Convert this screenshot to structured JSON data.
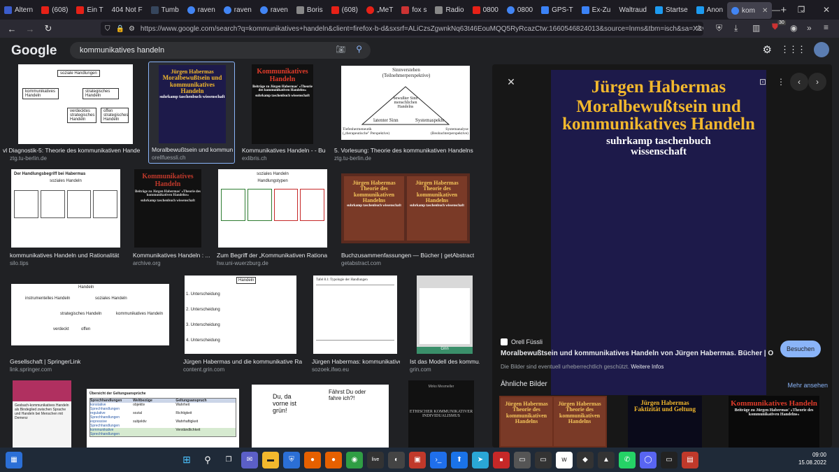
{
  "browser": {
    "tabs": [
      {
        "label": "Altern",
        "color": "#3b5ccc"
      },
      {
        "label": "(608)",
        "color": "#e62117"
      },
      {
        "label": "Ein T",
        "color": "#e62117"
      },
      {
        "label": "404 Not F",
        "color": "#555555"
      },
      {
        "label": "Tumb",
        "color": "#36465d"
      },
      {
        "label": "raven",
        "color": "#4285f4"
      },
      {
        "label": "raven",
        "color": "#4285f4"
      },
      {
        "label": "raven",
        "color": "#4285f4"
      },
      {
        "label": "Boris",
        "color": "#888888"
      },
      {
        "label": "(608)",
        "color": "#e62117"
      },
      {
        "label": "„MeT",
        "color": "#e62117"
      },
      {
        "label": "fox s",
        "color": "#cc3333"
      },
      {
        "label": "Radio",
        "color": "#888888"
      },
      {
        "label": "0800",
        "color": "#e62117"
      },
      {
        "label": "0800",
        "color": "#4285f4"
      },
      {
        "label": "GPS-T",
        "color": "#3b82f6"
      },
      {
        "label": "Ex-Zu",
        "color": "#3b82f6"
      },
      {
        "label": "Waltraud",
        "color": "#666666"
      },
      {
        "label": "Startse",
        "color": "#1d9bf0"
      },
      {
        "label": "Anon",
        "color": "#1d9bf0"
      },
      {
        "label": "kom",
        "color": "#4285f4"
      }
    ],
    "url": "https://www.google.com/search?q=kommunikatives+handeln&client=firefox-b-d&sxsrf=ALiCzsZgwnkNq63t46EouMQQ5RyRcazCtw:1660546824013&source=lnms&tbm=isch&sa=X&ved=2ahUKEwjKy8_6c",
    "badge": "30"
  },
  "google": {
    "logo": "Google",
    "query": "kommunikatives handeln"
  },
  "results": [
    {
      "caption": "vl Diagnostik-5: Theorie des kommunikativen Handelns",
      "source": "ztg.tu-berlin.de"
    },
    {
      "caption": "Moralbewußtsein und kommunikatives ...",
      "source": "orellfuessli.ch"
    },
    {
      "caption": "Kommunikatives Handeln - - Buch ...",
      "source": "exlibris.ch"
    },
    {
      "caption": "5. Vorlesung: Theorie des kommunikativen Handelns",
      "source": "ztg.tu-berlin.de"
    },
    {
      "caption": "kommunikatives Handeln und Rationalität",
      "source": "silo.tips"
    },
    {
      "caption": "Kommunikatives Handeln : ...",
      "source": "archive.org"
    },
    {
      "caption": "Zum Begriff der „Kommunikativen Rationalität ...",
      "source": "hw.uni-wuerzburg.de"
    },
    {
      "caption": "Buchzusammenfassungen — Bücher | getAbstract",
      "source": "getabstract.com"
    },
    {
      "caption": "Gesellschaft | SpringerLink",
      "source": "link.springer.com"
    },
    {
      "caption": "Jürgen Habermas und die kommunikative Rationalität ...",
      "source": "content.grin.com"
    },
    {
      "caption": "Jürgen Habermas: kommunikative ...",
      "source": "sozoek.ifwo.eu"
    },
    {
      "caption": "Ist das Modell des kommu...",
      "source": "grin.com"
    }
  ],
  "thumbs": {
    "t1": {
      "top": "soziale Handlungen",
      "left": "kommunikatives Handeln",
      "right": "strategisches Handeln",
      "b1": "verdecktes strategisches Handeln",
      "b2": "offen strategisches Handeln"
    },
    "t2": {
      "line1": "Jürgen Habermas",
      "line2": "Moralbewußtsein und kommunikatives Handeln",
      "line3": "suhrkamp taschenbuch wissenschaft"
    },
    "t3": {
      "line1": "Kommunikatives Handeln",
      "line2": "Beiträge zu Jürgen Habermas' »Theorie des kommunikativen Handelns«",
      "line3": "suhrkamp taschenbuch wissenschaft"
    },
    "t4": {
      "top": "Sinnverstehen (Teilnehmerperspektive)",
      "center": "bewußter Sinn menschlichen Handelns",
      "left": "latenter Sinn",
      "right": "Systemaspekte",
      "bl": "Tiefenhermeneutik („therapeutische\" Perspektive)",
      "br": "Systemanalyse (Beobachterperspektive)"
    },
    "t5": {
      "title": "Der Handlungsbegriff bei Habermas",
      "sub": "soziales Handeln"
    },
    "t6": {
      "line1": "Kommunikatives Handeln",
      "line2": "Beiträge zu Jürgen Habermas' »Theorie des kommunikativen Handelns«",
      "line3": "suhrkamp taschenbuch wissenschaft"
    },
    "t7": {
      "top": "soziales Handeln",
      "sub": "Handlungstypen"
    },
    "t8": {
      "line1": "Jürgen Habermas",
      "line2": "Theorie des kommunikativen Handelns",
      "line3": "suhrkamp taschenbuch wissenschaft"
    },
    "t9": {
      "top": "Handeln",
      "left": "instrumentelles Handeln",
      "right": "soziales Handeln",
      "mid": "strategisches Handeln",
      "r2": "kommunikatives Handeln",
      "b1": "verdeckt",
      "b2": "offen"
    },
    "t10": {
      "top": "Handeln",
      "a": "1. Unterscheidung",
      "b": "2. Unterscheidung",
      "c": "3. Unterscheidung",
      "d": "4. Unterscheidung"
    },
    "t11": {
      "title": "Tafel 8.1: Typologie der Handlungen"
    },
    "t12": {
      "title": "Grin"
    },
    "r5a": {
      "title": "Gesbach-kommunikatives Handeln als Bindeglied zwischen Sprache und Handeln bei Menschen mit Demenz"
    },
    "r5b": {
      "title": "Übersicht der Geltungsansprüche",
      "h1": "Sprechhandlungen",
      "h2": "Weltbezüge",
      "h3": "Geltungsanspruch",
      "r1": "konstative Sprechhandlungen",
      "r2": "regulative Sprechhandlungen",
      "r3": "expressive Sprechhandlungen",
      "r4": "kommunikative Sprechhandlungen",
      "v1": "objektiv",
      "v2": "sozial",
      "v3": "subjektiv",
      "w1": "Wahrheit",
      "w2": "Richtigkeit",
      "w3": "Wahrhaftigkeit",
      "w4": "Verständlichkeit"
    },
    "r5c": {
      "left": "Du, da vorne ist grün!",
      "right": "Fährst Du oder fahre ich?!"
    },
    "r5d": {
      "author": "Mirko Mesmeller",
      "title": "ETHISCHER KOMMUNIKATIVER INDIVIDUALISMUS"
    }
  },
  "panel": {
    "book": {
      "line1": "Jürgen Habermas",
      "line2": "Moralbewußtsein und kommunikatives Handeln",
      "line3": "suhrkamp taschenbuch wissenschaft"
    },
    "site": "Orell Füssli",
    "title": "Moralbewußtsein und kommunikatives Handeln von Jürgen Habermas. Bücher | Orell Füssli",
    "visit": "Besuchen",
    "copyright": "Die Bilder sind eventuell urheberrechtlich geschützt.",
    "more_info": "Weitere Infos",
    "similar": "Ähnliche Bilder",
    "see_more": "Mehr ansehen",
    "similar_items": [
      {
        "line1": "Jürgen Habermas",
        "line2": "Theorie des kommunikativen Handelns"
      },
      {
        "line1": "Jürgen Habermas",
        "line2": "Faktizität und Geltung"
      },
      {
        "line1": "Kommunikatives Handeln",
        "line2": "Beiträge zu Jürgen Habermas' »Theorie des kommunikativen Handelns«"
      }
    ]
  },
  "taskbar": {
    "time": "09:00",
    "date": "15.08.2022"
  }
}
